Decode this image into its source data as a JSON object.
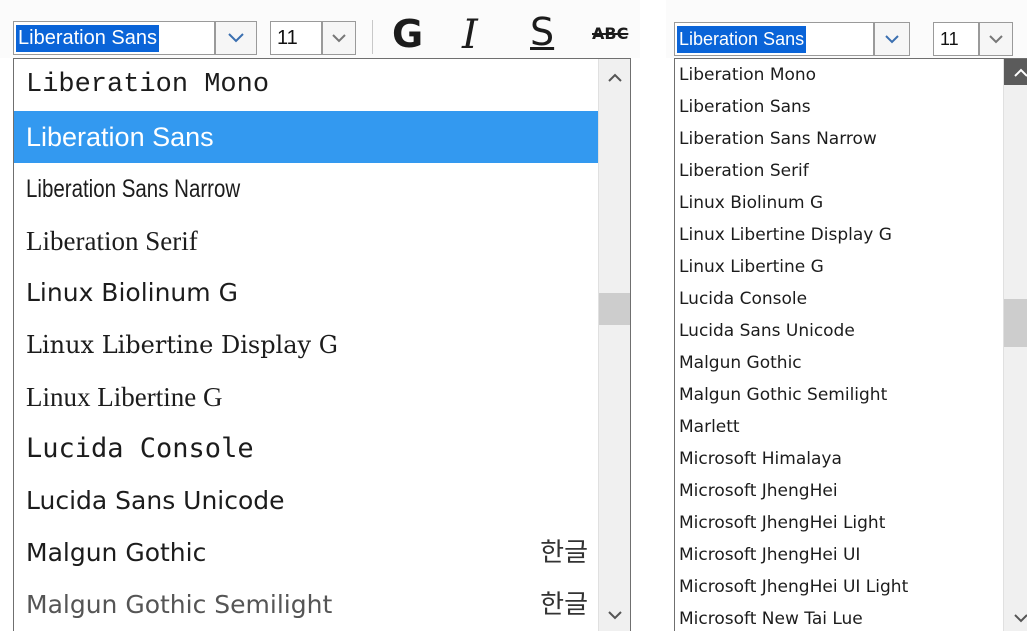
{
  "left": {
    "font_value": "Liberation Sans",
    "size_value": "11",
    "format": {
      "bold": "G",
      "italic": "I",
      "underline": "S",
      "strike": "ABC"
    },
    "font_list": {
      "items": [
        {
          "label": "Liberation Mono"
        },
        {
          "label": "Liberation Sans"
        },
        {
          "label": "Liberation Sans Narrow"
        },
        {
          "label": "Liberation Serif"
        },
        {
          "label": "Linux Biolinum G"
        },
        {
          "label": "Linux Libertine Display G"
        },
        {
          "label": "Linux Libertine G"
        },
        {
          "label": "Lucida Console"
        },
        {
          "label": "Lucida Sans Unicode"
        },
        {
          "label": "Malgun Gothic",
          "hint": "한글"
        },
        {
          "label": "Malgun Gothic Semilight",
          "hint": "한글"
        }
      ],
      "selected": "Liberation Sans"
    }
  },
  "right": {
    "font_value": "Liberation Sans",
    "size_value": "11",
    "font_list": {
      "items": [
        {
          "label": "Liberation Mono"
        },
        {
          "label": "Liberation Sans"
        },
        {
          "label": "Liberation Sans Narrow"
        },
        {
          "label": "Liberation Serif"
        },
        {
          "label": "Linux Biolinum G"
        },
        {
          "label": "Linux Libertine Display G"
        },
        {
          "label": "Linux Libertine G"
        },
        {
          "label": "Lucida Console"
        },
        {
          "label": "Lucida Sans Unicode"
        },
        {
          "label": "Malgun Gothic"
        },
        {
          "label": "Malgun Gothic Semilight"
        },
        {
          "label": "Marlett"
        },
        {
          "label": "Microsoft Himalaya"
        },
        {
          "label": "Microsoft JhengHei"
        },
        {
          "label": "Microsoft JhengHei Light"
        },
        {
          "label": "Microsoft JhengHei UI"
        },
        {
          "label": "Microsoft JhengHei UI Light"
        },
        {
          "label": "Microsoft New Tai Lue"
        }
      ]
    }
  },
  "colors": {
    "selection": "#0a64d8",
    "list_highlight": "#3399f0",
    "scroll_thumb": "#cdcdcd"
  }
}
